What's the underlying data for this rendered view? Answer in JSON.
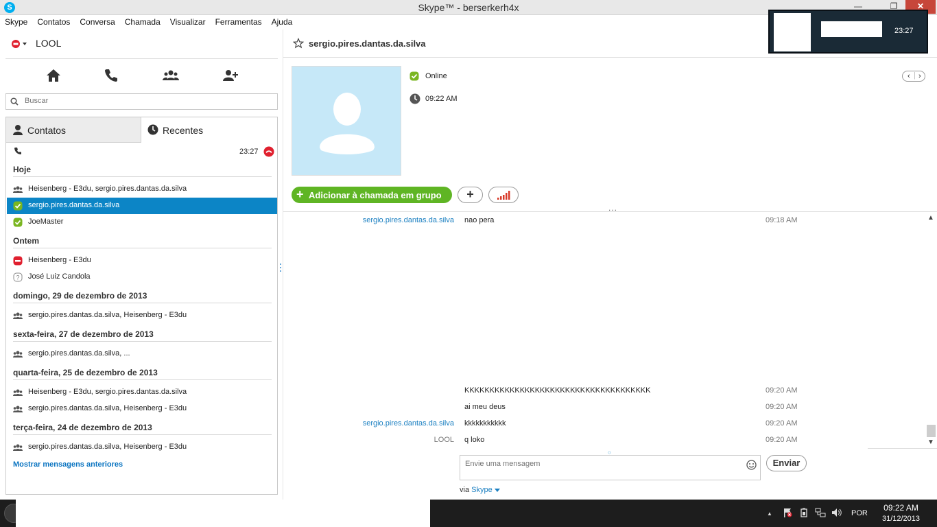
{
  "window": {
    "title": "Skype™ - berserkerh4x",
    "app_icon": "S"
  },
  "menu": [
    "Skype",
    "Contatos",
    "Conversa",
    "Chamada",
    "Visualizar",
    "Ferramentas",
    "Ajuda"
  ],
  "profile": {
    "name": "LOOL"
  },
  "search": {
    "placeholder": "Buscar"
  },
  "tabs": {
    "contacts": "Contatos",
    "recent": "Recentes"
  },
  "recent_call": {
    "time": "23:27"
  },
  "sections": {
    "today": "Hoje",
    "yesterday": "Ontem",
    "d29": "domingo, 29 de dezembro de 2013",
    "d27": "sexta-feira, 27 de dezembro de 2013",
    "d25": "quarta-feira, 25 de dezembro de 2013",
    "d24": "terça-feira, 24 de dezembro de 2013"
  },
  "rows": {
    "today1": "Heisenberg  - E3du, sergio.pires.dantas.da.silva",
    "today2": "sergio.pires.dantas.da.silva",
    "today3": "JoeMaster",
    "yest1": "Heisenberg  - E3du",
    "yest2": "José Luiz Candola",
    "d29_1": "sergio.pires.dantas.da.silva, Heisenberg  - E3du",
    "d27_1": "sergio.pires.dantas.da.silva, ...",
    "d25_1": "Heisenberg  - E3du, sergio.pires.dantas.da.silva",
    "d25_2": "sergio.pires.dantas.da.silva, Heisenberg  - E3du",
    "d24_1": "sergio.pires.dantas.da.silva, Heisenberg  - E3du"
  },
  "show_older": "Mostrar mensagens anteriores",
  "conversation": {
    "title": "sergio.pires.dantas.da.silva",
    "status": "Online",
    "local_time": "09:22 AM",
    "add_group_call": "Adicionar à chamada em grupo",
    "more": "..."
  },
  "messages": [
    {
      "sender": "sergio.pires.dantas.da.silva",
      "text": "nao pera",
      "time": "09:18 AM"
    },
    {
      "sender": "",
      "text": "KKKKKKKKKKKKKKKKKKKKKKKKKKKKKKKKKKKKK",
      "time": "09:20 AM"
    },
    {
      "sender": "",
      "text": "ai meu deus",
      "time": "09:20 AM"
    },
    {
      "sender": "sergio.pires.dantas.da.silva",
      "text": "kkkkkkkkkkk",
      "time": "09:20 AM"
    },
    {
      "sender": "LOOL",
      "text": "q loko",
      "time": "09:20 AM"
    }
  ],
  "compose": {
    "placeholder": "Envie uma mensagem",
    "send": "Enviar",
    "via_prefix": "via",
    "via_service": "Skype"
  },
  "notification": {
    "time": "23:27"
  },
  "taskbar": {
    "lang": "POR",
    "time": "09:22 AM",
    "date": "31/12/2013"
  },
  "colors": {
    "accent": "#0c85c6",
    "online": "#7ab621",
    "call_green": "#5fb524",
    "end_call_red": "#e0202f",
    "link": "#1a7fc1"
  }
}
